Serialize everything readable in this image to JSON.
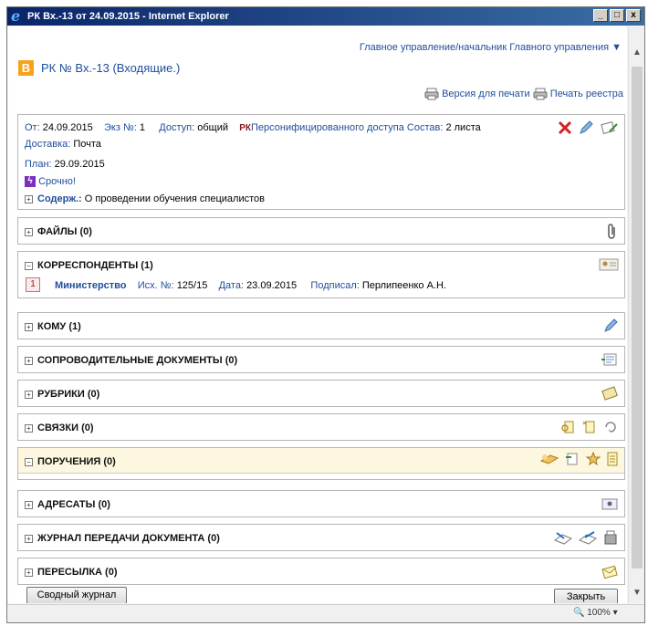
{
  "window": {
    "title": "РК Вх.-13 от 24.09.2015 - Internet Explorer",
    "min_label": "_",
    "max_label": "□",
    "close_label": "x"
  },
  "breadcrumb": "Главное управление/начальник Главного управления ▼",
  "logo_letter": "В",
  "rk_title": "РК № Вх.-13   (Входящие.)",
  "print": {
    "version_label": "Версия для печати",
    "registry_label": "Печать реестра"
  },
  "info": {
    "from_label": "От:",
    "from_value": "24.09.2015",
    "copy_label": "Экз №:",
    "copy_value": "1",
    "access_label": "Доступ:",
    "access_value": "общий",
    "rk_mark": "РК",
    "personified_label": "Персонифицированного доступа",
    "sostav_label": "Состав:",
    "sostav_value": "2 листа",
    "delivery_label": "Доставка:",
    "delivery_value": "Почта",
    "plan_label": "План:",
    "plan_value": "29.09.2015",
    "urgent_label": "Срочно!",
    "content_label": "Содерж.:",
    "content_value": "О проведении обучения специалистов"
  },
  "sections": {
    "files": "ФАЙЛЫ (0)",
    "correspondents": "КОРРЕСПОНДЕНТЫ (1)",
    "to": "КОМУ (1)",
    "accompanying": "СОПРОВОДИТЕЛЬНЫЕ ДОКУМЕНТЫ (0)",
    "rubrics": "РУБРИКИ (0)",
    "links": "СВЯЗКИ (0)",
    "assignments": "ПОРУЧЕНИЯ (0)",
    "addressees": "АДРЕСАТЫ (0)",
    "journal": "ЖУРНАЛ ПЕРЕДАЧИ ДОКУМЕНТА (0)",
    "forwarding": "ПЕРЕСЫЛКА (0)"
  },
  "correspondent": {
    "number": "1",
    "name": "Министерство",
    "out_label": "Исх. №:",
    "out_value": "125/15",
    "date_label": "Дата:",
    "date_value": "23.09.2015",
    "signed_label": "Подписал:",
    "signed_value": "Перлипеенко А.Н."
  },
  "buttons": {
    "summary_journal": "Сводный журнал",
    "close": "Закрыть"
  },
  "status": {
    "zoom": "100%"
  },
  "colors": {
    "accent_link": "#1f4e9b",
    "logo": "#f7a21b",
    "highlight_panel": "#fdf7df"
  }
}
